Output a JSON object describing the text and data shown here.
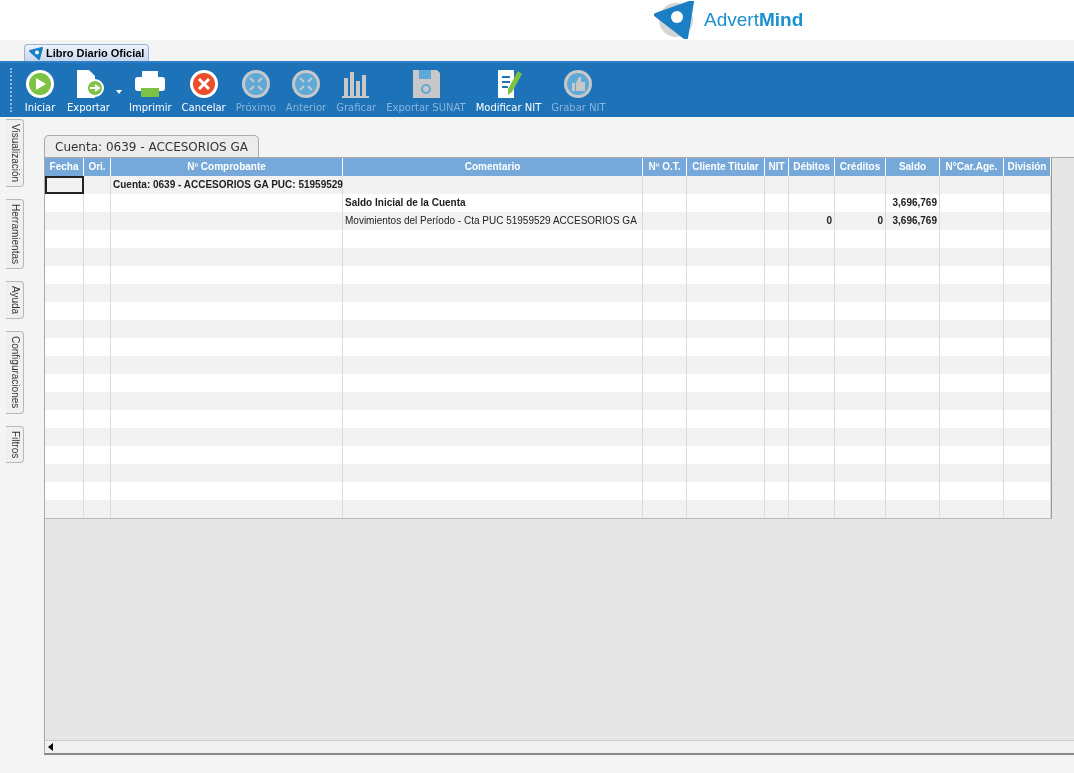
{
  "brand": {
    "name_light": "Advert",
    "name_bold": "Mind"
  },
  "document_tab": {
    "label": "Libro Diario Oficial",
    "selected": true
  },
  "toolbar": [
    {
      "label": "Iniciar",
      "disabled": false,
      "dropdown": false
    },
    {
      "label": "Exportar",
      "disabled": false,
      "dropdown": true
    },
    {
      "label": "Imprimir",
      "disabled": false,
      "dropdown": false
    },
    {
      "label": "Cancelar",
      "disabled": false,
      "dropdown": false
    },
    {
      "label": "Próximo",
      "disabled": true,
      "dropdown": false
    },
    {
      "label": "Anterior",
      "disabled": true,
      "dropdown": false
    },
    {
      "label": "Graficar",
      "disabled": true,
      "dropdown": false
    },
    {
      "label": "Exportar SUNAT",
      "disabled": true,
      "dropdown": false
    },
    {
      "label": "Modificar NIT",
      "disabled": false,
      "dropdown": false
    },
    {
      "label": "Grabar NIT",
      "disabled": true,
      "dropdown": false
    }
  ],
  "side_tabs": [
    {
      "label": "Visualización"
    },
    {
      "label": "Herramientas"
    },
    {
      "label": "Ayuda"
    },
    {
      "label": "Configuraciones"
    },
    {
      "label": "Filtros"
    }
  ],
  "panel_tab": {
    "label": "Cuenta: 0639 - ACCESORIOS GA"
  },
  "table": {
    "columns": [
      {
        "label": "Fecha"
      },
      {
        "label": "Ori."
      },
      {
        "label": "Nº Comprobante"
      },
      {
        "label": "Comentario"
      },
      {
        "label": "Nº O.T."
      },
      {
        "label": "Cliente Titular"
      },
      {
        "label": "NIT"
      },
      {
        "label": "Débitos"
      },
      {
        "label": "Créditos"
      },
      {
        "label": "Saldo"
      },
      {
        "label": "N°Car.Age."
      },
      {
        "label": "División"
      }
    ],
    "rows": [
      {
        "kind": "account",
        "selected": true,
        "comprobante": "Cuenta: 0639 - ACCESORIOS GA PUC: 51959529"
      },
      {
        "kind": "opening",
        "selected": false,
        "comentario": "Saldo Inicial de la Cuenta",
        "saldo": "3,696,769"
      },
      {
        "kind": "movement",
        "selected": false,
        "comentario": "Movimientos del Período - Cta PUC 51959529 ACCESORIOS GA",
        "debitos": "0",
        "creditos": "0",
        "saldo": "3,696,769"
      }
    ]
  }
}
